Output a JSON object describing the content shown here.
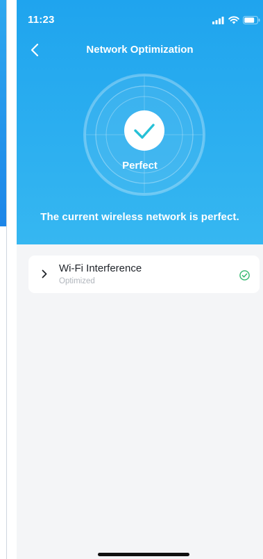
{
  "status_bar": {
    "time": "11:23",
    "icons": [
      "signal-icon",
      "wifi-icon",
      "battery-icon"
    ]
  },
  "header": {
    "title": "Network Optimization",
    "back_icon": "chevron-left-icon"
  },
  "hero": {
    "result_label": "Perfect",
    "result_icon": "checkmark-icon",
    "message": "The current wireless network is perfect."
  },
  "items": [
    {
      "title": "Wi-Fi Interference",
      "status": "Optimized",
      "expand_icon": "chevron-right-icon",
      "status_icon": "check-circle-icon"
    }
  ],
  "colors": {
    "hero_top": "#1fa4ee",
    "hero_bottom": "#36b7f1",
    "check_teal": "#27c1d7",
    "success_green": "#32b86e",
    "background": "#f4f5f7"
  }
}
